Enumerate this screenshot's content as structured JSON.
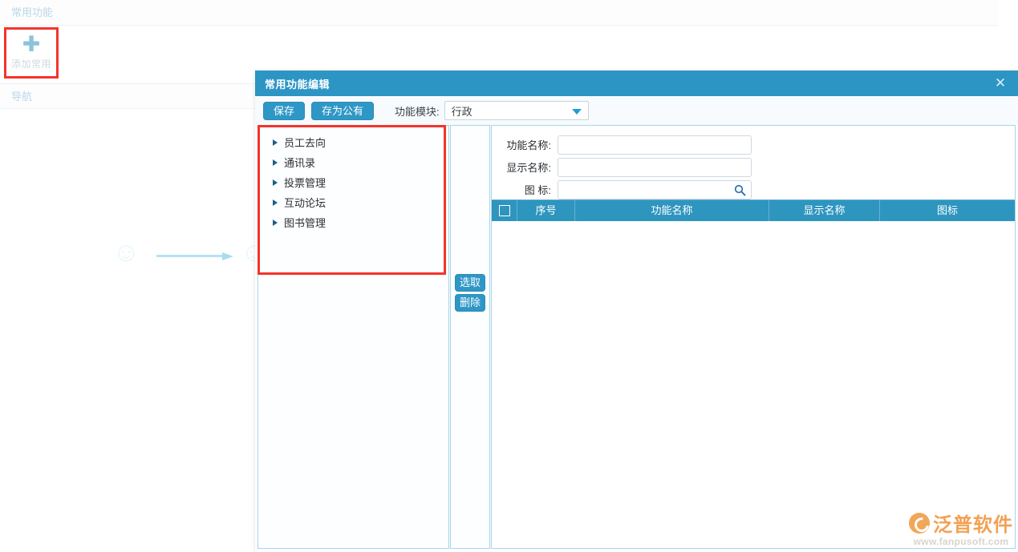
{
  "background": {
    "common_section_title": "常用功能",
    "nav_section_title": "导航",
    "add_tile": {
      "icon": "plus-icon",
      "label": "添加常用"
    }
  },
  "dialog": {
    "title": "常用功能编辑",
    "close_icon": "close-icon",
    "toolbar": {
      "save_label": "保存",
      "save_public_label": "存为公有",
      "module_label": "功能模块:",
      "module_value": "行政",
      "module_caret_icon": "chevron-down-icon"
    },
    "tree": {
      "items": [
        {
          "label": "员工去向",
          "arrow_icon": "chevron-right-icon"
        },
        {
          "label": "通讯录",
          "arrow_icon": "chevron-right-icon"
        },
        {
          "label": "投票管理",
          "arrow_icon": "chevron-right-icon"
        },
        {
          "label": "互动论坛",
          "arrow_icon": "chevron-right-icon"
        },
        {
          "label": "图书管理",
          "arrow_icon": "chevron-right-icon"
        }
      ]
    },
    "transfer_buttons": {
      "select_label": "选取",
      "delete_label": "删除"
    },
    "form": {
      "function_name_label": "功能名称:",
      "function_name_value": "",
      "display_name_label": "显示名称:",
      "display_name_value": "",
      "icon_label": "图 标:",
      "icon_value": "",
      "icon_search_icon": "search-icon"
    },
    "grid": {
      "select_all_icon": "checkbox-unchecked-icon",
      "columns": [
        "序号",
        "功能名称",
        "显示名称",
        "图标"
      ],
      "rows": []
    }
  },
  "watermark": {
    "brand": "泛普软件",
    "url": "www.fanpusoft.com",
    "logo_icon": "fanpu-logo-icon"
  },
  "colors": {
    "title_bar": "#2c95c4",
    "button": "#2e97c6",
    "grid_header": "#2e95bf",
    "panel_border": "#a7d6e8",
    "annotation": "#f4342b",
    "watermark_brand": "#f2a154"
  }
}
